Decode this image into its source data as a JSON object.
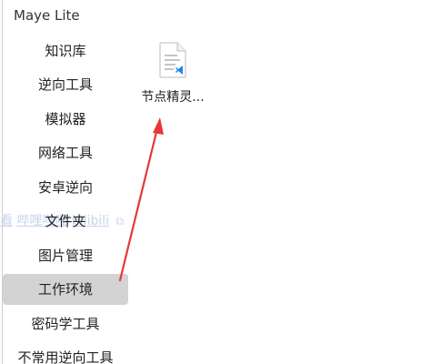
{
  "window": {
    "title": "Maye Lite"
  },
  "sidebar": {
    "items": [
      {
        "label": "知识库"
      },
      {
        "label": "逆向工具"
      },
      {
        "label": "模拟器"
      },
      {
        "label": "网络工具"
      },
      {
        "label": "安卓逆向"
      },
      {
        "label": "文件夹"
      },
      {
        "label": "图片管理"
      },
      {
        "label": "工作环境"
      },
      {
        "label": "密码学工具"
      },
      {
        "label": "不常用逆向工具"
      }
    ],
    "active_label": "工作环境"
  },
  "background": {
    "link_fragment_1": "看",
    "link_fragment_2": "哔哩哔哩",
    "link_fragment_3": "bilibili",
    "external_icon": "external-link-icon"
  },
  "main": {
    "file": {
      "label": "节点精灵...",
      "icon": "vscode-file-icon"
    },
    "annotation": {
      "color": "#e53935"
    }
  },
  "colors": {
    "active_item_bg": "#d3d3d3",
    "arrow": "#e53935",
    "faded_link": "#c6d4ee"
  }
}
